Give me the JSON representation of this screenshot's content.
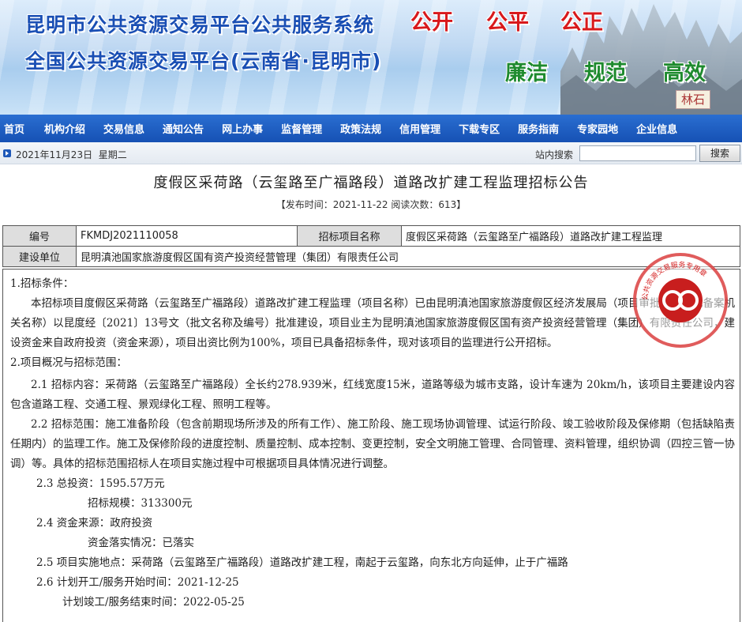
{
  "banner": {
    "title_line1": "昆明市公共资源交易平台公共服务系统",
    "title_line2": "全国公共资源交易平台(云南省·昆明市)",
    "slogan_red": [
      "公开",
      "公平",
      "公正"
    ],
    "slogan_green": [
      "廉洁",
      "规范",
      "高效"
    ],
    "seal_text": "林石",
    "colors": {
      "title_blue": "#1a4fb4",
      "slogan_red": "#d8191c",
      "slogan_green": "#1e8a2e"
    }
  },
  "nav": {
    "items": [
      "首页",
      "机构介绍",
      "交易信息",
      "通知公告",
      "网上办事",
      "监督管理",
      "政策法规",
      "信用管理",
      "下载专区",
      "服务指南",
      "专家园地",
      "企业信息"
    ],
    "background": "#1651b4"
  },
  "datebar": {
    "date": "2021年11月23日",
    "weekday": "星期二",
    "search_label": "站内搜索",
    "search_value": "",
    "search_button": "搜索"
  },
  "article": {
    "title": "度假区采荷路（云玺路至广福路段）道路改扩建工程监理招标公告",
    "meta": "【发布时间：2021-11-22   阅读次数：613】"
  },
  "info_table": {
    "row1": {
      "label1": "编号",
      "value1": "FKMDJ2021110058",
      "label2": "招标项目名称",
      "value2": "度假区采荷路（云玺路至广福路段）道路改扩建工程监理"
    },
    "row2": {
      "label1": "建设单位",
      "value1": "昆明滇池国家旅游度假区国有资产投资经营管理（集团）有限责任公司"
    }
  },
  "body": {
    "s1_heading": "1.招标条件：",
    "s1_text": "本招标项目度假区采荷路（云玺路至广福路段）道路改扩建工程监理（项目名称）已由昆明滇池国家旅游度假区经济发展局（项目审批、核准或备案机关名称）以昆度经〔2021〕13号文（批文名称及编号）批准建设，项目业主为昆明滇池国家旅游度假区国有资产投资经营管理（集团）有限责任公司，建设资金来自政府投资（资金来源），项目出资比例为100%，项目已具备招标条件，现对该项目的监理进行公开招标。",
    "s2_heading": "2.项目概况与招标范围：",
    "s21": "2.1 招标内容：采荷路（云玺路至广福路段）全长约278.939米，红线宽度15米，道路等级为城市支路，设计车速为 20km/h，该项目主要建设内容包含道路工程、交通工程、景观绿化工程、照明工程等。",
    "s22": "2.2 招标范围：施工准备阶段（包含前期现场所涉及的所有工作）、施工阶段、施工现场协调管理、试运行阶段、竣工验收阶段及保修期（包括缺陷责任期内）的监理工作。施工及保修阶段的进度控制、质量控制、成本控制、变更控制，安全文明施工管理、合同管理、资料管理，组织协调（四控三管一协调）等。具体的招标范围招标人在项目实施过程中可根据项目具体情况进行调整。",
    "s23": "2.3 总投资：1595.57万元",
    "s23b": "招标规模：313300元",
    "s24": "2.4 资金来源：政府投资",
    "s24b": "资金落实情况：已落实",
    "s25": "2.5 项目实施地点：采荷路（云玺路至广福路段）道路改扩建工程，南起于云玺路，向东北方向延伸，止于广福路",
    "s26": "2.6 计划开工/服务开始时间：2021-12-25",
    "s26b": "计划竣工/服务结束时间：2022-05-25"
  },
  "stamp": {
    "ring_text": "公共资源交易服务专用章",
    "color": "#d62626"
  }
}
